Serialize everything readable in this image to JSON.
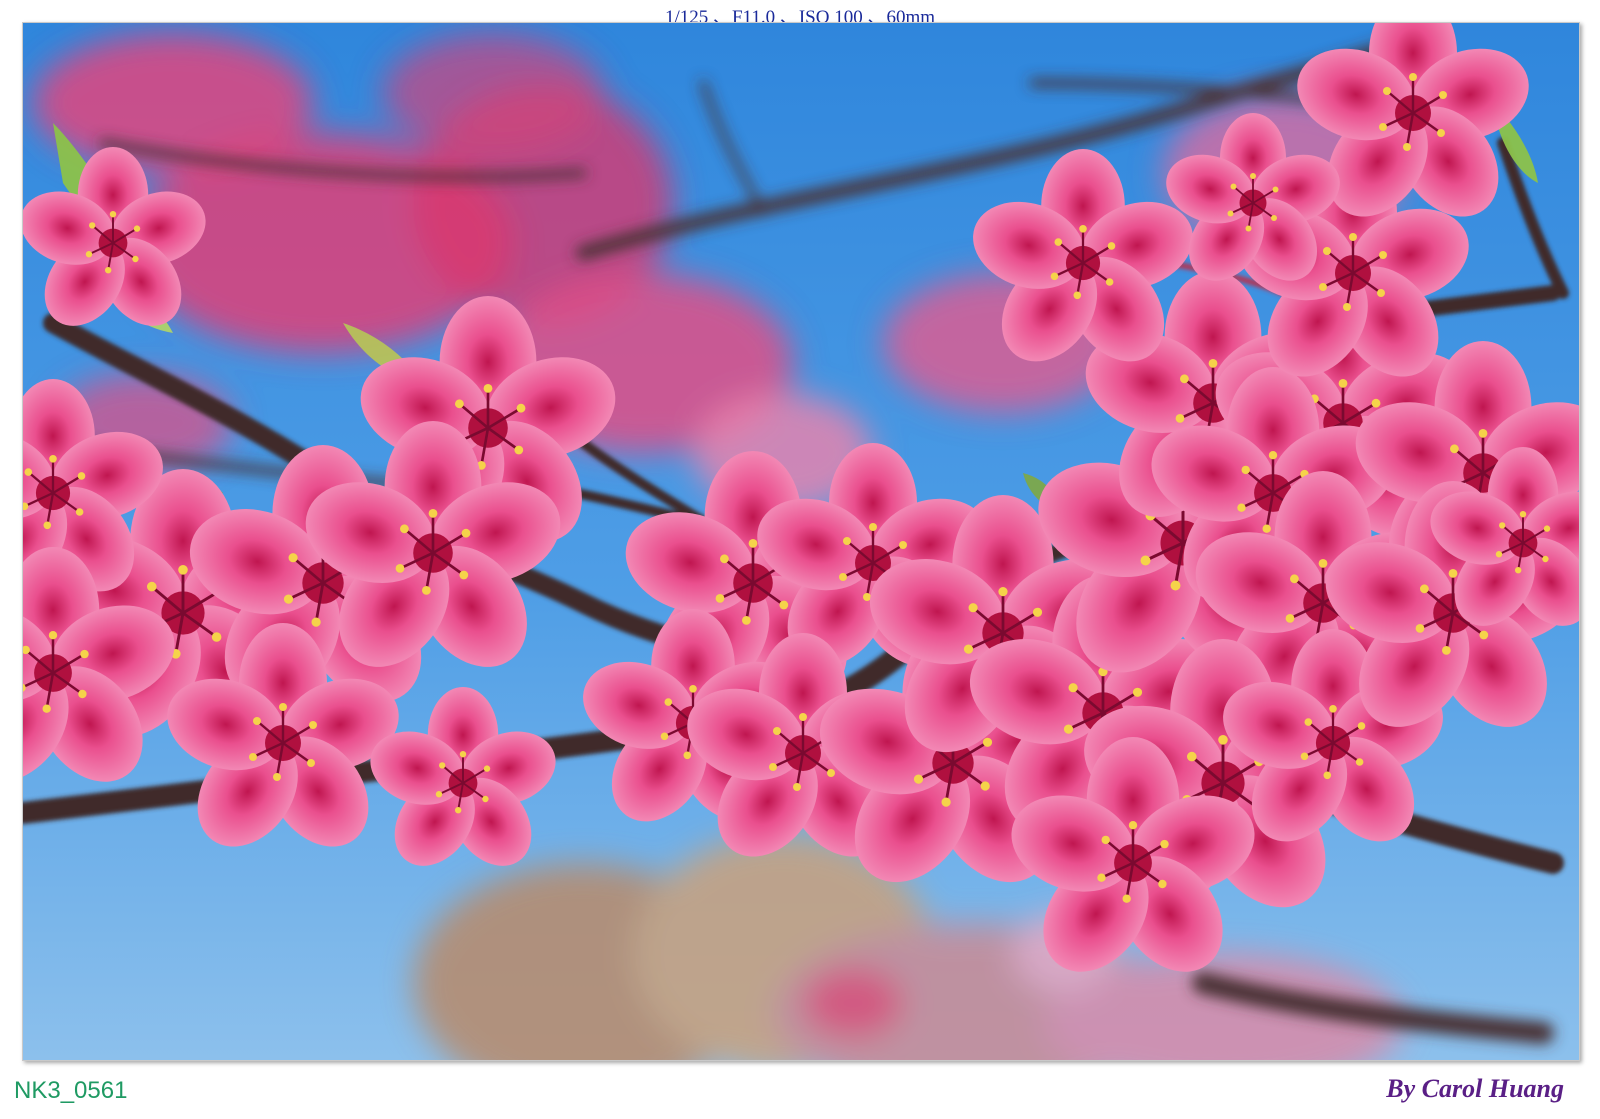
{
  "exif_caption": "1/125 、F11.0 、ISO 100 、60mm",
  "file_name": "NK3_0561",
  "signature": "By Carol Huang",
  "colors": {
    "sky": "#3f95e0",
    "blossom": "#e84f8c",
    "branch": "#4a3530",
    "exif_text": "#1a2a9a",
    "file_name_text": "#1f9a63",
    "signature_text": "#5a1f86"
  }
}
